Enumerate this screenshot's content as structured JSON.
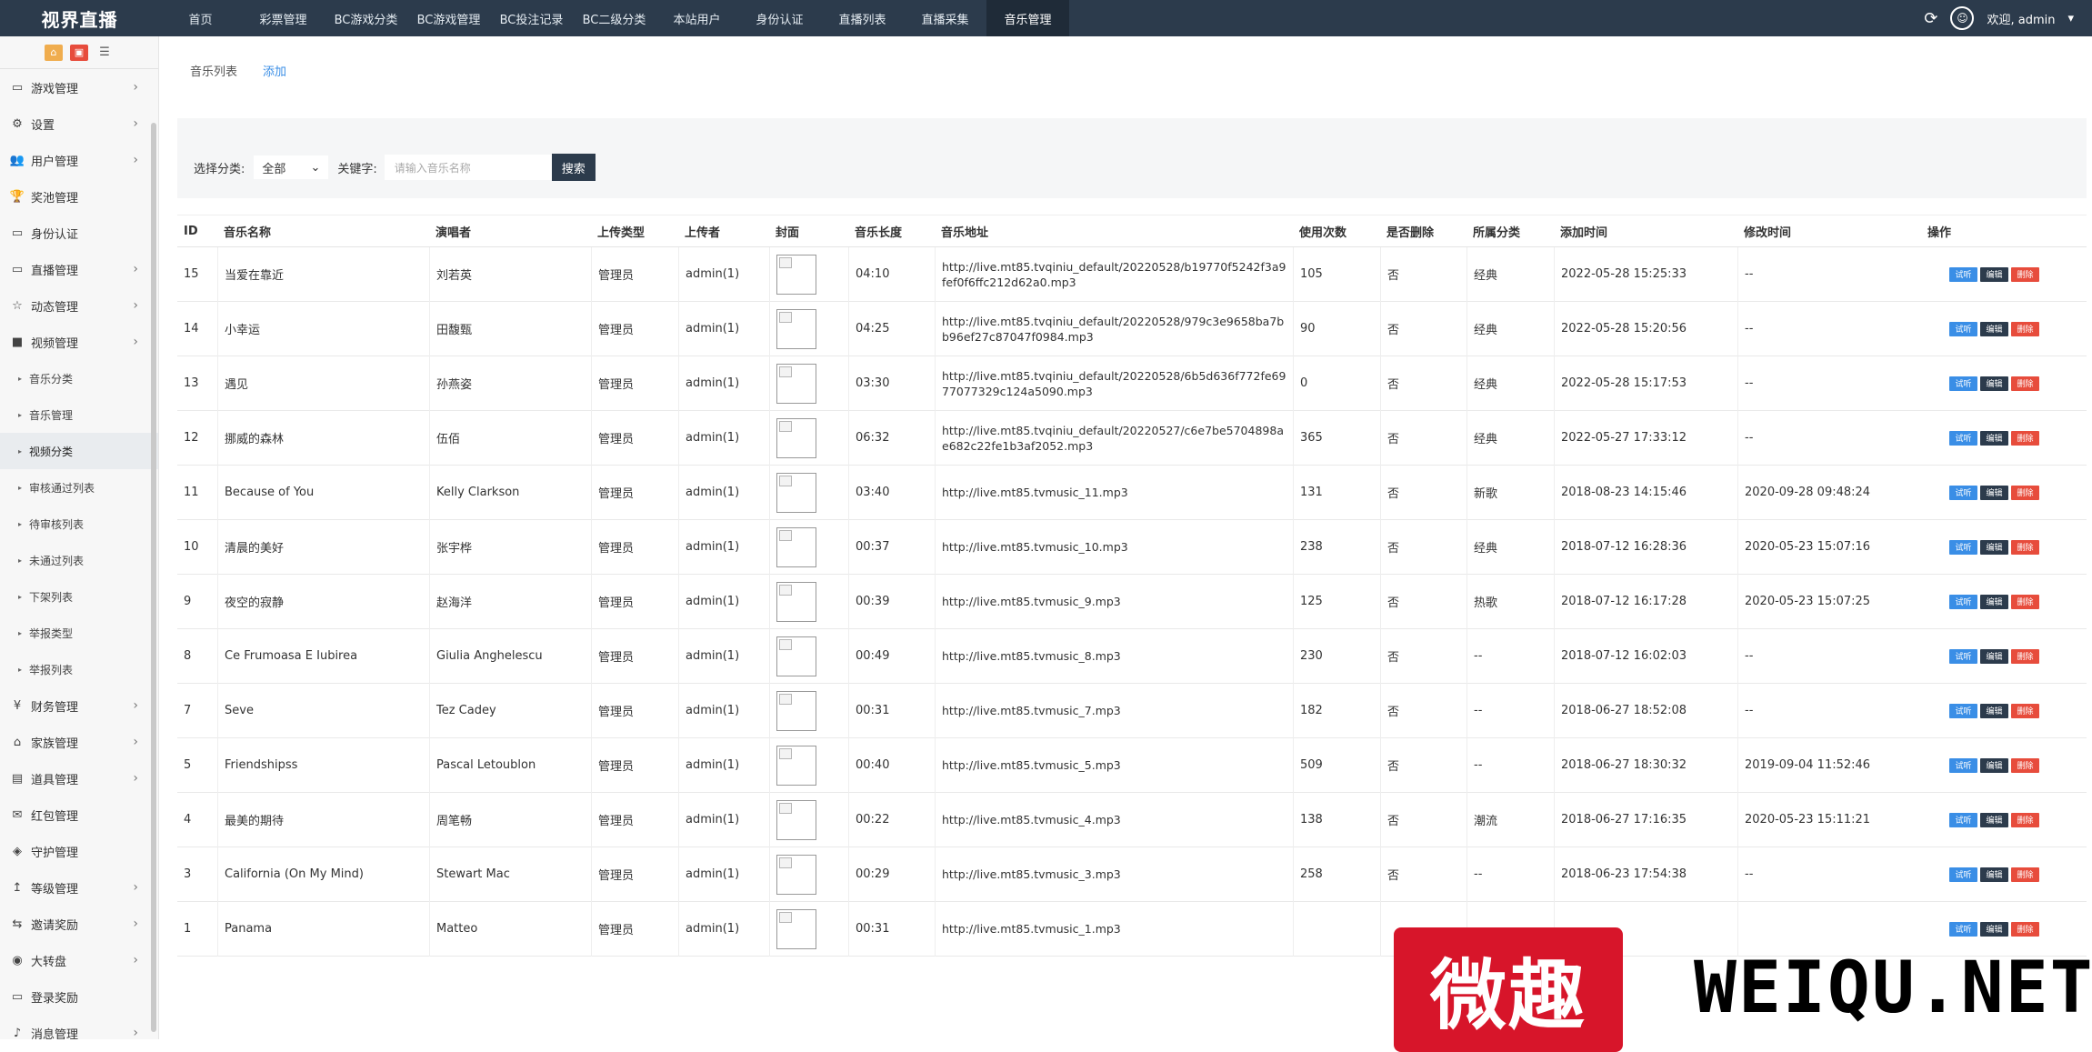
{
  "app": {
    "brand": "视界直播",
    "welcome": "欢迎, admin"
  },
  "topnav": [
    "首页",
    "彩票管理",
    "BC游戏分类",
    "BC游戏管理",
    "BC投注记录",
    "BC二级分类",
    "本站用户",
    "身份认证",
    "直播列表",
    "直播采集",
    "音乐管理"
  ],
  "sidebar": {
    "items": [
      {
        "label": "游戏管理",
        "icon": "monitor-icon",
        "chevron": true
      },
      {
        "label": "设置",
        "icon": "gears-icon",
        "chevron": true
      },
      {
        "label": "用户管理",
        "icon": "users-icon",
        "chevron": true
      },
      {
        "label": "奖池管理",
        "icon": "trophy-icon",
        "chevron": false
      },
      {
        "label": "身份认证",
        "icon": "monitor-icon",
        "chevron": false
      },
      {
        "label": "直播管理",
        "icon": "monitor-icon",
        "chevron": true
      },
      {
        "label": "动态管理",
        "icon": "star-icon",
        "chevron": true
      },
      {
        "label": "视频管理",
        "icon": "video-camera-icon",
        "chevron": true
      },
      {
        "label": "音乐分类",
        "sub": true
      },
      {
        "label": "音乐管理",
        "sub": true
      },
      {
        "label": "视频分类",
        "sub": true,
        "active": true
      },
      {
        "label": "审核通过列表",
        "sub": true
      },
      {
        "label": "待审核列表",
        "sub": true
      },
      {
        "label": "未通过列表",
        "sub": true
      },
      {
        "label": "下架列表",
        "sub": true
      },
      {
        "label": "举报类型",
        "sub": true
      },
      {
        "label": "举报列表",
        "sub": true
      },
      {
        "label": "财务管理",
        "icon": "yen-icon",
        "chevron": true
      },
      {
        "label": "家族管理",
        "icon": "bank-icon",
        "chevron": true
      },
      {
        "label": "道具管理",
        "icon": "cart-icon",
        "chevron": true
      },
      {
        "label": "红包管理",
        "icon": "envelope-icon",
        "chevron": false
      },
      {
        "label": "守护管理",
        "icon": "shield-icon",
        "chevron": false
      },
      {
        "label": "等级管理",
        "icon": "level-up-icon",
        "chevron": true
      },
      {
        "label": "邀请奖励",
        "icon": "share-icon",
        "chevron": true
      },
      {
        "label": "大转盘",
        "icon": "wheel-icon",
        "chevron": true
      },
      {
        "label": "登录奖励",
        "icon": "monitor-icon",
        "chevron": false
      },
      {
        "label": "消息管理",
        "icon": "bell-icon",
        "chevron": true
      }
    ]
  },
  "tabs": {
    "list": "音乐列表",
    "add": "添加"
  },
  "filter": {
    "category_label": "选择分类:",
    "category_value": "全部",
    "keyword_label": "关键字:",
    "keyword_placeholder": "请输入音乐名称",
    "search": "搜索"
  },
  "table": {
    "headers": [
      "ID",
      "音乐名称",
      "演唱者",
      "上传类型",
      "上传者",
      "封面",
      "音乐长度",
      "音乐地址",
      "使用次数",
      "是否删除",
      "所属分类",
      "添加时间",
      "修改时间",
      "操作"
    ],
    "ops": {
      "play": "试听",
      "edit": "编辑",
      "delete": "删除"
    },
    "rows": [
      {
        "id": "15",
        "name": "当爱在靠近",
        "singer": "刘若英",
        "type": "管理员",
        "uploader": "admin(1)",
        "length": "04:10",
        "url": "http://live.mt85.tvqiniu_default/20220528/b19770f5242f3a9fef0f6ffc212d62a0.mp3",
        "uses": "105",
        "deleted": "否",
        "category": "经典",
        "added": "2022-05-28 15:25:33",
        "modified": "--"
      },
      {
        "id": "14",
        "name": "小幸运",
        "singer": "田馥甄",
        "type": "管理员",
        "uploader": "admin(1)",
        "length": "04:25",
        "url": "http://live.mt85.tvqiniu_default/20220528/979c3e9658ba7bb96ef27c87047f0984.mp3",
        "uses": "90",
        "deleted": "否",
        "category": "经典",
        "added": "2022-05-28 15:20:56",
        "modified": "--"
      },
      {
        "id": "13",
        "name": "遇见",
        "singer": "孙燕姿",
        "type": "管理员",
        "uploader": "admin(1)",
        "length": "03:30",
        "url": "http://live.mt85.tvqiniu_default/20220528/6b5d636f772fe6977077329c124a5090.mp3",
        "uses": "0",
        "deleted": "否",
        "category": "经典",
        "added": "2022-05-28 15:17:53",
        "modified": "--"
      },
      {
        "id": "12",
        "name": "挪威的森林",
        "singer": "伍佰",
        "type": "管理员",
        "uploader": "admin(1)",
        "length": "06:32",
        "url": "http://live.mt85.tvqiniu_default/20220527/c6e7be5704898ae682c22fe1b3af2052.mp3",
        "uses": "365",
        "deleted": "否",
        "category": "经典",
        "added": "2022-05-27 17:33:12",
        "modified": "--"
      },
      {
        "id": "11",
        "name": "Because of You",
        "singer": "Kelly Clarkson",
        "type": "管理员",
        "uploader": "admin(1)",
        "length": "03:40",
        "url": "http://live.mt85.tvmusic_11.mp3",
        "uses": "131",
        "deleted": "否",
        "category": "新歌",
        "added": "2018-08-23 14:15:46",
        "modified": "2020-09-28 09:48:24"
      },
      {
        "id": "10",
        "name": "清晨的美好",
        "singer": "张宇桦",
        "type": "管理员",
        "uploader": "admin(1)",
        "length": "00:37",
        "url": "http://live.mt85.tvmusic_10.mp3",
        "uses": "238",
        "deleted": "否",
        "category": "经典",
        "added": "2018-07-12 16:28:36",
        "modified": "2020-05-23 15:07:16"
      },
      {
        "id": "9",
        "name": "夜空的寂静",
        "singer": "赵海洋",
        "type": "管理员",
        "uploader": "admin(1)",
        "length": "00:39",
        "url": "http://live.mt85.tvmusic_9.mp3",
        "uses": "125",
        "deleted": "否",
        "category": "热歌",
        "added": "2018-07-12 16:17:28",
        "modified": "2020-05-23 15:07:25"
      },
      {
        "id": "8",
        "name": "Ce Frumoasa E Iubirea",
        "singer": "Giulia Anghelescu",
        "type": "管理员",
        "uploader": "admin(1)",
        "length": "00:49",
        "url": "http://live.mt85.tvmusic_8.mp3",
        "uses": "230",
        "deleted": "否",
        "category": "--",
        "added": "2018-07-12 16:02:03",
        "modified": "--"
      },
      {
        "id": "7",
        "name": "Seve",
        "singer": "Tez Cadey",
        "type": "管理员",
        "uploader": "admin(1)",
        "length": "00:31",
        "url": "http://live.mt85.tvmusic_7.mp3",
        "uses": "182",
        "deleted": "否",
        "category": "--",
        "added": "2018-06-27 18:52:08",
        "modified": "--"
      },
      {
        "id": "5",
        "name": "Friendshipss",
        "singer": "Pascal Letoublon",
        "type": "管理员",
        "uploader": "admin(1)",
        "length": "00:40",
        "url": "http://live.mt85.tvmusic_5.mp3",
        "uses": "509",
        "deleted": "否",
        "category": "--",
        "added": "2018-06-27 18:30:32",
        "modified": "2019-09-04 11:52:46"
      },
      {
        "id": "4",
        "name": "最美的期待",
        "singer": "周笔畅",
        "type": "管理员",
        "uploader": "admin(1)",
        "length": "00:22",
        "url": "http://live.mt85.tvmusic_4.mp3",
        "uses": "138",
        "deleted": "否",
        "category": "潮流",
        "added": "2018-06-27 17:16:35",
        "modified": "2020-05-23 15:11:21"
      },
      {
        "id": "3",
        "name": "California (On My Mind)",
        "singer": "Stewart Mac",
        "type": "管理员",
        "uploader": "admin(1)",
        "length": "00:29",
        "url": "http://live.mt85.tvmusic_3.mp3",
        "uses": "258",
        "deleted": "否",
        "category": "--",
        "added": "2018-06-23 17:54:38",
        "modified": "--"
      },
      {
        "id": "1",
        "name": "Panama",
        "singer": "Matteo",
        "type": "管理员",
        "uploader": "admin(1)",
        "length": "00:31",
        "url": "http://live.mt85.tvmusic_1.mp3",
        "uses": "",
        "deleted": "",
        "category": "",
        "added": "",
        "modified": ""
      }
    ]
  },
  "watermark": {
    "cn": "微趣",
    "en": "WEIQU.NET"
  }
}
